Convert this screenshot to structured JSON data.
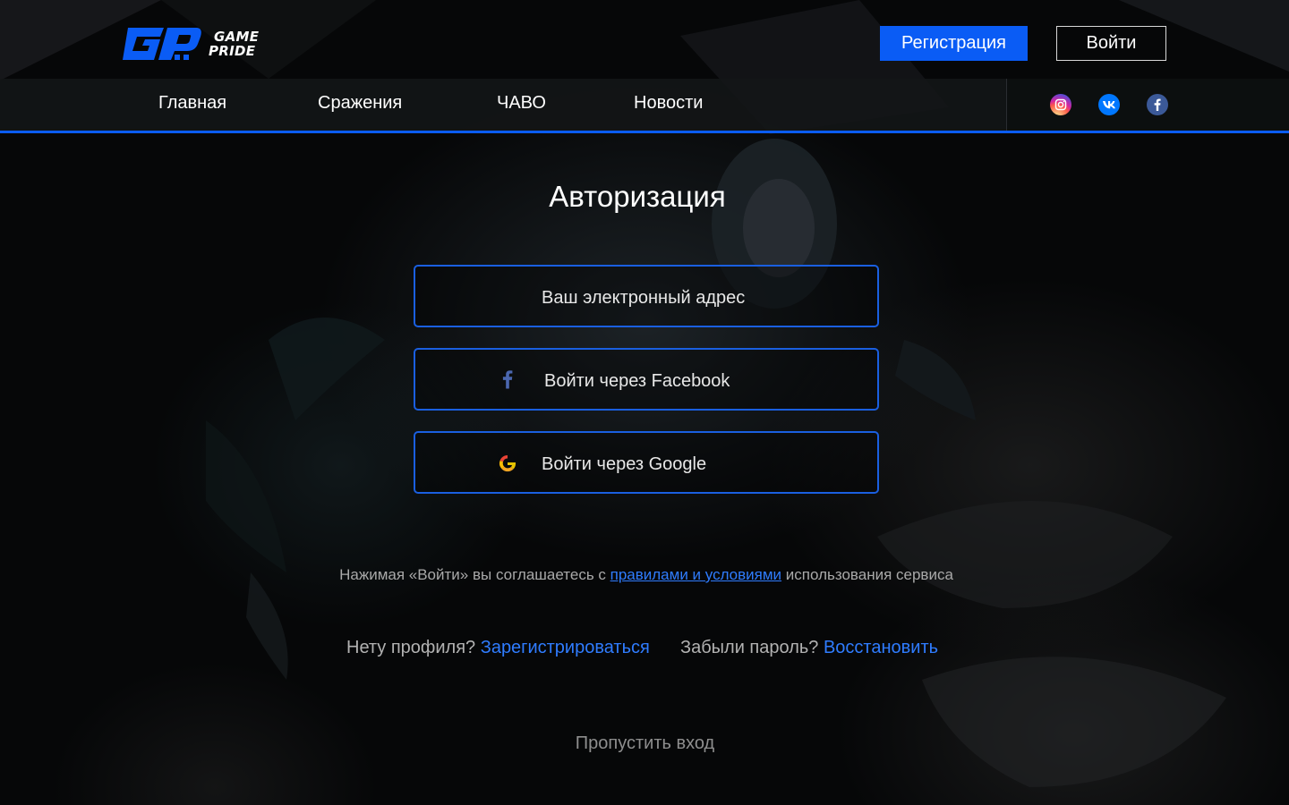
{
  "header": {
    "logo_line1": "GAME",
    "logo_line2": "PRIDE",
    "register_label": "Регистрация",
    "login_label": "Войти"
  },
  "nav": {
    "items": [
      "Главная",
      "Сражения",
      "ЧАВО",
      "Новости"
    ]
  },
  "social": [
    "instagram-icon",
    "vk-icon",
    "facebook-icon"
  ],
  "auth": {
    "title": "Авторизация",
    "email_placeholder": "Ваш электронный адрес",
    "facebook_label": "Войти через Facebook",
    "google_label": "Войти через Google",
    "terms_before": "Нажимая «Войти» вы соглашаетесь с ",
    "terms_link": "правилами и условиями",
    "terms_after": " использования сервиса",
    "no_profile": "Нету профиля? ",
    "register_link": "Зарегистрироваться",
    "forgot_password": "Забыли пароль? ",
    "restore_link": "Восстановить",
    "skip": "Пропустить вход"
  },
  "colors": {
    "accent": "#0a5cf5",
    "link": "#2f7cff",
    "background": "#060708",
    "facebook": "#3b5998",
    "vk": "#0077ff"
  }
}
